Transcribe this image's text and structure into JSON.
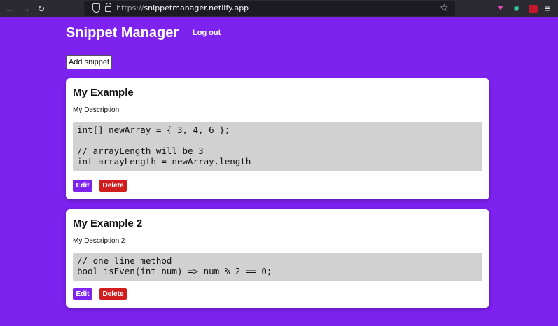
{
  "browser": {
    "url_scheme": "https://",
    "url_host": "snippetmanager.netlify.app",
    "icons": {
      "back": "arrow-left-icon",
      "forward": "arrow-right-icon",
      "reload": "reload-icon",
      "bookmark": "star-icon",
      "menu": "hamburger-menu-icon"
    }
  },
  "header": {
    "title": "Snippet Manager",
    "logout_label": "Log out"
  },
  "toolbar": {
    "add_label": "Add snippet"
  },
  "snippets": [
    {
      "title": "My Example",
      "description": "My Description",
      "code": "int[] newArray = { 3, 4, 6 };\n\n// arrayLength will be 3\nint arrayLength = newArray.length",
      "edit_label": "Edit",
      "delete_label": "Delete"
    },
    {
      "title": "My Example 2",
      "description": "My Description 2",
      "code": "// one line method\nbool isEven(int num) => num % 2 == 0;",
      "edit_label": "Edit",
      "delete_label": "Delete"
    }
  ],
  "colors": {
    "background": "#7e22f0",
    "edit_button": "#7e22f0",
    "delete_button": "#d01d1d",
    "code_background": "#d1d1d1"
  }
}
